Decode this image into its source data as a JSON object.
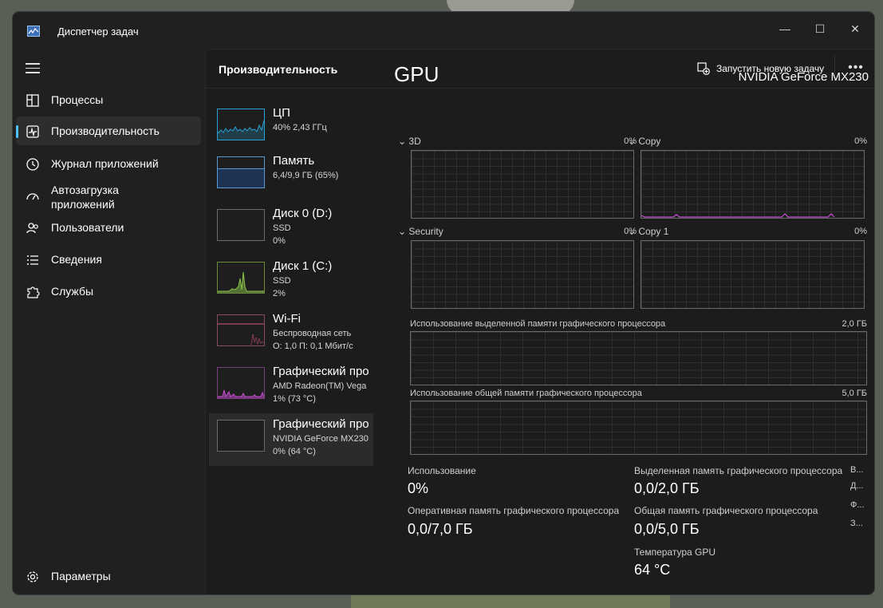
{
  "window": {
    "title": "Диспетчер задач"
  },
  "nav": {
    "items": [
      {
        "label": "Процессы"
      },
      {
        "label": "Производительность"
      },
      {
        "label": "Журнал приложений"
      },
      {
        "label": "Автозагрузка приложений"
      },
      {
        "label": "Пользователи"
      },
      {
        "label": "Сведения"
      },
      {
        "label": "Службы"
      }
    ],
    "settings": "Параметры"
  },
  "header": {
    "title": "Производительность",
    "run_task": "Запустить новую задачу",
    "more": "•••"
  },
  "devices": [
    {
      "name": "ЦП",
      "line1": "40% 2,43 ГГц",
      "line2": "",
      "color": "#2aa1d5"
    },
    {
      "name": "Память",
      "line1": "6,4/9,9 ГБ (65%)",
      "line2": "",
      "color": "#5b9bd5"
    },
    {
      "name": "Диск 0 (D:)",
      "line1": "SSD",
      "line2": "0%",
      "color": "#8bc34a"
    },
    {
      "name": "Диск 1 (C:)",
      "line1": "SSD",
      "line2": "2%",
      "color": "#8bc34a"
    },
    {
      "name": "Wi-Fi",
      "line1": "Беспроводная сеть",
      "line2": "О: 1,0 П: 0,1 Мбит/с",
      "color": "#d9567a"
    },
    {
      "name": "Графический про",
      "line1": "AMD Radeon(TM) Vega",
      "line2": "1% (73 °C)",
      "color": "#c64ed2"
    },
    {
      "name": "Графический про",
      "line1": "NVIDIA GeForce MX230",
      "line2": "0% (64 °C)",
      "color": "#c64ed2"
    }
  ],
  "gpu": {
    "title": "GPU",
    "model": "NVIDIA GeForce MX230",
    "engines": [
      {
        "name": "3D",
        "pct": "0%"
      },
      {
        "name": "Copy",
        "pct": "0%"
      },
      {
        "name": "Security",
        "pct": "0%"
      },
      {
        "name": "Copy 1",
        "pct": "0%"
      }
    ],
    "dedicated_label": "Использование выделенной памяти графического процессора",
    "dedicated_max": "2,0 ГБ",
    "shared_label": "Использование общей памяти графического процессора",
    "shared_max": "5,0 ГБ",
    "stats": {
      "usage_label": "Использование",
      "usage_value": "0%",
      "ded_label": "Выделенная память графического процессора",
      "ded_value": "0,0/2,0 ГБ",
      "ram_label": "Оперативная память графического процессора",
      "ram_value": "0,0/7,0 ГБ",
      "shared_label": "Общая память графического процессора",
      "shared_value": "0,0/5,0 ГБ",
      "temp_label": "Температура GPU",
      "temp_value": "64 °C"
    },
    "side_truncated": [
      "В...",
      "Д...",
      "Ф...",
      "З..."
    ]
  },
  "colors": {
    "accent": "#4cc2ff",
    "gpu_line": "#c64ed2"
  }
}
